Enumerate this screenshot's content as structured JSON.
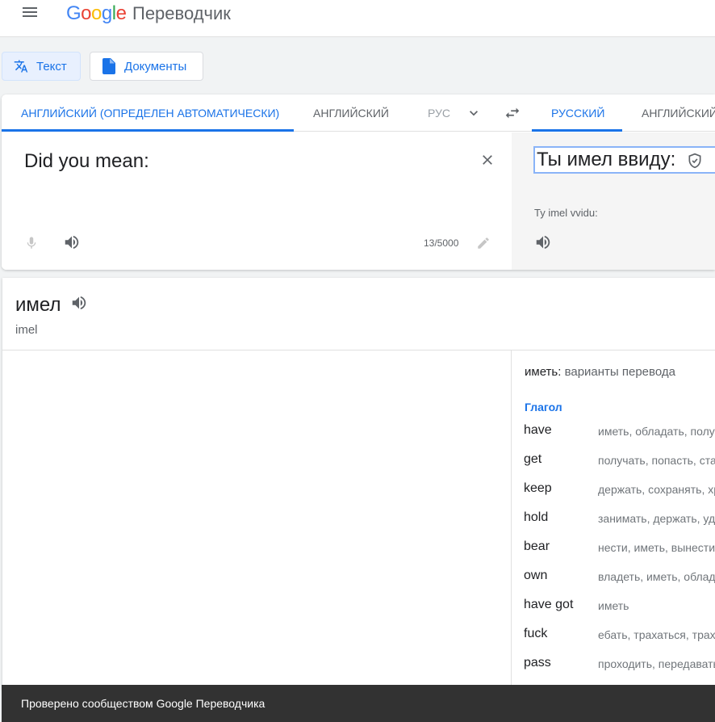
{
  "header": {
    "logo": [
      "G",
      "o",
      "o",
      "g",
      "l",
      "e"
    ],
    "app_name": "Переводчик"
  },
  "modes": {
    "text_label": "Текст",
    "docs_label": "Документы"
  },
  "languages": {
    "source_tabs": [
      "Английский (определен автоматически)",
      "Английский",
      "Рус"
    ],
    "target_tabs": [
      "Русский",
      "Английский"
    ]
  },
  "source": {
    "text": "Did you mean:",
    "counter": "13/5000"
  },
  "target": {
    "text": "Ты имел ввиду:",
    "transliteration": "Ty imel vvidu:"
  },
  "dictionary": {
    "word": "имел",
    "word_translit": "imel",
    "title_word": "иметь:",
    "title_rest": "варианты перевода",
    "part_of_speech": "Глагол",
    "entries": [
      {
        "word": "have",
        "translations": "иметь, обладать, получать"
      },
      {
        "word": "get",
        "translations": "получать, попасть, стать"
      },
      {
        "word": "keep",
        "translations": "держать, сохранять, хранить"
      },
      {
        "word": "hold",
        "translations": "занимать, держать, удерживать"
      },
      {
        "word": "bear",
        "translations": "нести, иметь, вынести"
      },
      {
        "word": "own",
        "translations": "владеть, иметь, обладать"
      },
      {
        "word": "have got",
        "translations": "иметь"
      },
      {
        "word": "fuck",
        "translations": "ебать, трахаться, трахать"
      },
      {
        "word": "pass",
        "translations": "проходить, передавать"
      }
    ]
  },
  "toast": {
    "text": "Проверено сообществом Google Переводчика"
  },
  "colors": {
    "accent": "#1a73e8",
    "toast_bg": "#323232"
  }
}
